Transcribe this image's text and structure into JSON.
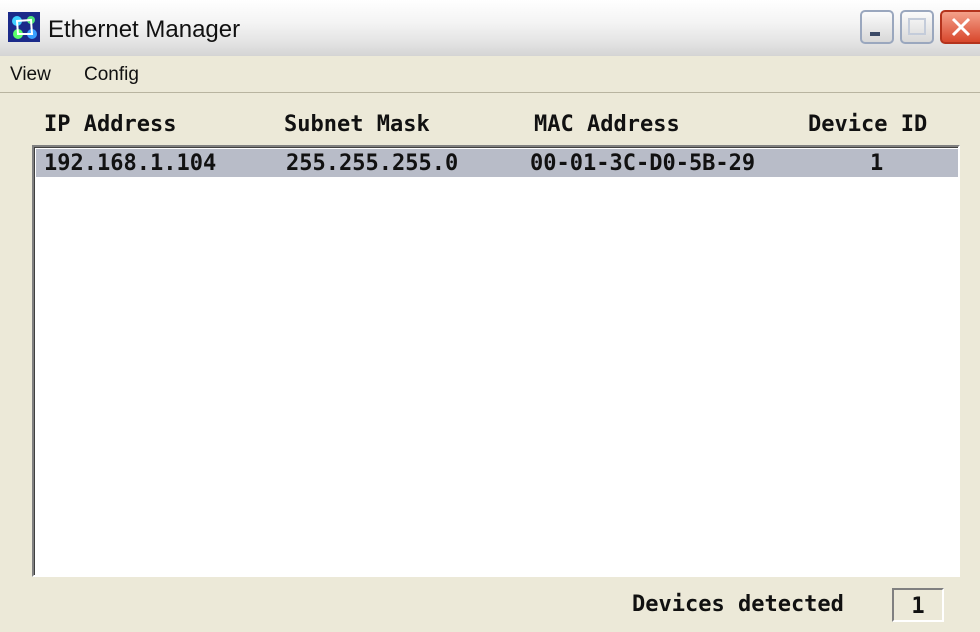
{
  "window": {
    "title": "Ethernet Manager",
    "icon": "network-app-icon"
  },
  "title_buttons": {
    "minimize_icon": "minimize-icon",
    "maximize_icon": "maximize-icon",
    "close_icon": "close-icon"
  },
  "menu": {
    "items": [
      {
        "label": "View"
      },
      {
        "label": "Config"
      }
    ]
  },
  "table": {
    "columns": [
      "IP Address",
      "Subnet Mask",
      "MAC Address",
      "Device ID"
    ],
    "rows": [
      {
        "ip": "192.168.1.104",
        "subnet": "255.255.255.0",
        "mac": "00-01-3C-D0-5B-29",
        "device_id": "1",
        "selected": true
      }
    ]
  },
  "status": {
    "label": "Devices detected",
    "value": "1"
  },
  "colors": {
    "selected_row": "#b8bcc8",
    "window_bg": "#ece9d8",
    "close_button": "#d8472c"
  }
}
